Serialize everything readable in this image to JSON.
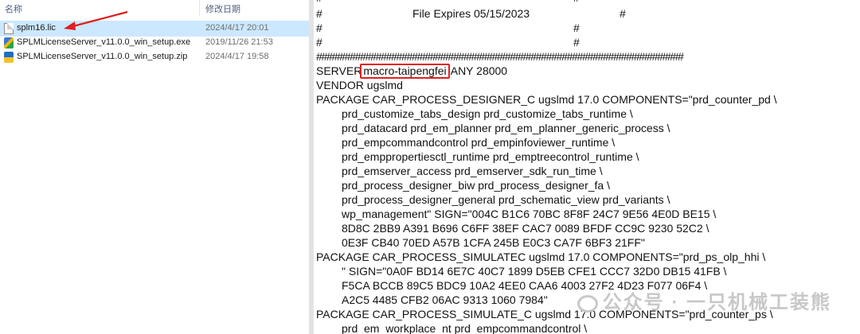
{
  "explorer": {
    "headers": {
      "name": "名称",
      "date": "修改日期"
    },
    "files": [
      {
        "name": "splm16.lic",
        "date": "2024/4/17 20:01",
        "icon": "document-icon"
      },
      {
        "name": "SPLMLicenseServer_v11.0.0_win_setup.exe",
        "date": "2019/11/26 21:53",
        "icon": "installer-icon"
      },
      {
        "name": "SPLMLicenseServer_v11.0.0_win_setup.zip",
        "date": "2024/4/17 19:58",
        "icon": "zip-icon"
      }
    ]
  },
  "document": {
    "hash_top": "#                                                      #",
    "expires_hash1": "#",
    "expires_text": "File Expires 05/15/2023",
    "expires_hash2": "#",
    "hash_a1": "#",
    "hash_a2": "#",
    "hash_b1": "#",
    "hash_b2": "#",
    "hash_line": "#######################################################################",
    "server_prefix": "SERVER",
    "server_host": "macro-taipengfei",
    "server_suffix": "ANY 28000",
    "vendor": "VENDOR ugslmd",
    "lines": [
      "PACKAGE CAR_PROCESS_DESIGNER_C ugslmd 17.0 COMPONENTS=\"prd_counter_pd \\",
      "prd_customize_tabs_design prd_customize_tabs_runtime \\",
      "prd_datacard prd_em_planner prd_em_planner_generic_process \\",
      "prd_empcommandcontrol prd_empinfoviewer_runtime \\",
      "prd_emppropertiesctl_runtime prd_emptreecontrol_runtime \\",
      "prd_emserver_access prd_emserver_sdk_run_time \\",
      "prd_process_designer_biw prd_process_designer_fa \\",
      "prd_process_designer_general prd_schematic_view prd_variants \\",
      "wp_management\" SIGN=\"004C B1C6 70BC 8F8F 24C7 9E56 4E0D BE15 \\",
      "8D8C 2BB9 A391 B696 C6FF 38EF CAC7 0089 BFDF CC9C 9230 52C2 \\",
      "0E3F CB40 70ED A57B 1CFA 245B E0C3 CA7F 6BF3 21FF\"",
      "PACKAGE CAR_PROCESS_SIMULATEC ugslmd 17.0 COMPONENTS=\"prd_ps_olp_hhi \\",
      "\" SIGN=\"0A0F BD14 6E7C 40C7 1899 D5EB CFE1 CCC7 32D0 DB15 41FB \\",
      "F5CA BCCB 89C5 BDC9 10A2 4EE0 CAA6 4003 27F2 4D23 F077 06F4 \\",
      "A2C5 4485 CFB2 06AC 9313 1060 7984\"",
      "PACKAGE CAR_PROCESS_SIMULATE_C ugslmd 17.0 COMPONENTS=\"prd_counter_ps \\",
      "prd_em_workplace_nt prd_empcommandcontrol \\"
    ]
  },
  "watermark": "公众号 · 一只机械工装熊",
  "colors": {
    "highlight_box": "#e02020",
    "arrow": "#e02020",
    "selected_row": "#cce8ff"
  }
}
